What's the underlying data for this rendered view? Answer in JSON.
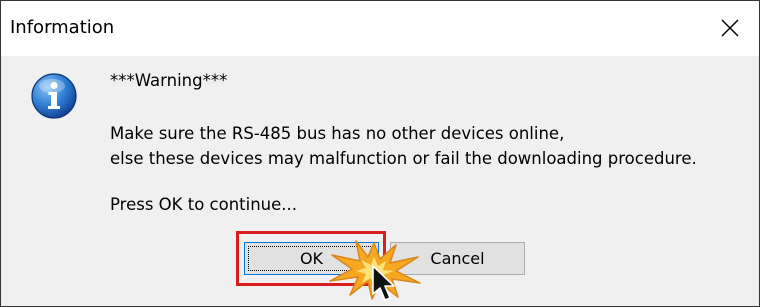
{
  "window": {
    "title": "Information"
  },
  "icons": {
    "info": "information-icon",
    "close": "close-icon",
    "burst": "click-burst-icon",
    "cursor": "mouse-pointer-icon"
  },
  "message": {
    "warning": "***Warning***",
    "line1": "Make sure the RS-485 bus has no other devices online,",
    "line2": "else these devices may malfunction or fail the downloading procedure.",
    "line3": "Press OK to continue..."
  },
  "buttons": {
    "ok_label": "OK",
    "cancel_label": "Cancel"
  },
  "colors": {
    "highlight": "#d81e1e",
    "focus_border": "#0078d7",
    "burst_fill": "#f7a823",
    "info_blue": "#1d5fb8"
  }
}
